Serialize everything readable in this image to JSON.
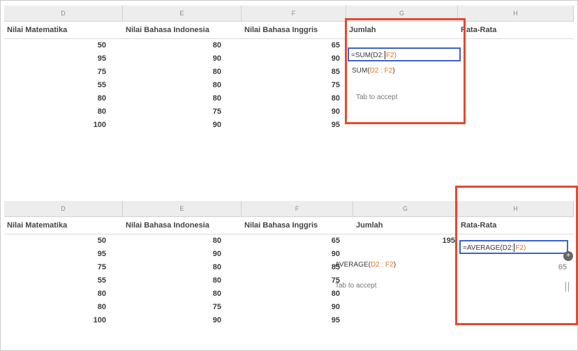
{
  "columns": [
    "D",
    "E",
    "F",
    "G",
    "H"
  ],
  "headers": [
    "Nilai Matematika",
    "Nilai Bahasa Indonesia",
    "Nilai Bahasa Inggris",
    "Jumlah",
    "Rata-Rata"
  ],
  "top": {
    "rows": [
      [
        "50",
        "80",
        "65"
      ],
      [
        "95",
        "90",
        "90"
      ],
      [
        "75",
        "80",
        "85"
      ],
      [
        "55",
        "80",
        "75"
      ],
      [
        "80",
        "80",
        "80"
      ],
      [
        "80",
        "75",
        "90"
      ],
      [
        "100",
        "90",
        "95"
      ]
    ],
    "formula_prefix": "=SUM(D2:",
    "formula_range": "F2)",
    "hint_fn": "SUM(",
    "hint_range": "D2 : F2",
    "hint_close": ")",
    "tab_hint": "Tab  to accept"
  },
  "bottom": {
    "rows": [
      [
        "50",
        "80",
        "65"
      ],
      [
        "95",
        "90",
        "90"
      ],
      [
        "75",
        "80",
        "85"
      ],
      [
        "55",
        "80",
        "75"
      ],
      [
        "80",
        "80",
        "80"
      ],
      [
        "80",
        "75",
        "90"
      ],
      [
        "100",
        "90",
        "95"
      ]
    ],
    "jumlah_first": "195",
    "formula_prefix": "=AVERAGE(D2:",
    "formula_range": "F2)",
    "hint_fn": "AVERAGE(",
    "hint_range": "D2 : F2",
    "hint_close": ")",
    "tab_hint": "Tab  to accept",
    "rata_preview": "65",
    "fill_handle_symbol": "+"
  },
  "colors": {
    "highlight": "#e4492e",
    "range": "#e0742c",
    "edit_border": "#3c62c7"
  }
}
